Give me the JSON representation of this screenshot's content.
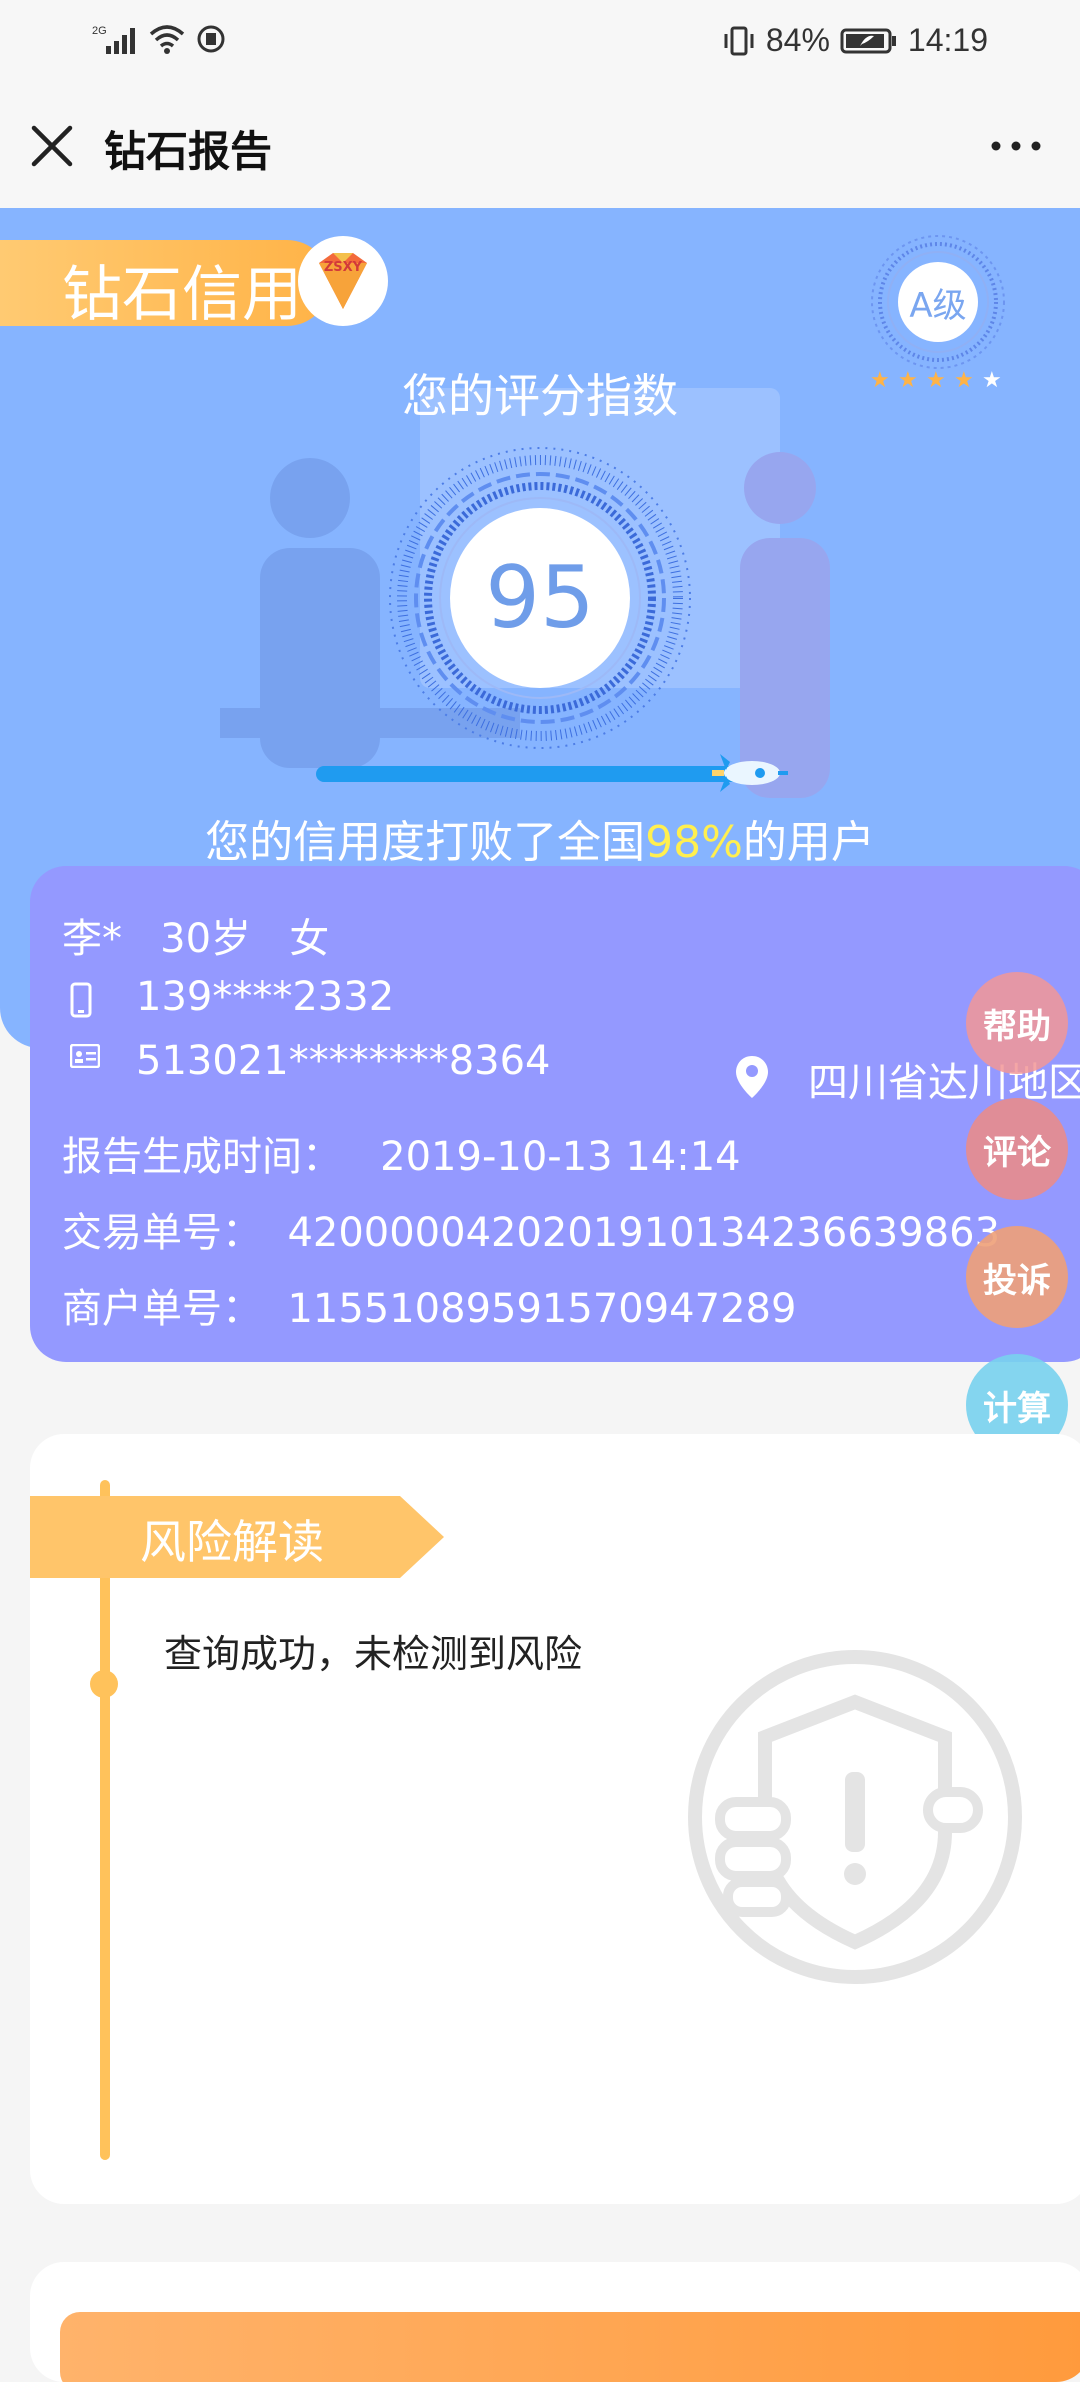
{
  "status_bar": {
    "network": "2G",
    "battery": "84%",
    "time": "14:19"
  },
  "titlebar": {
    "title": "钻石报告"
  },
  "hero": {
    "brand": "钻石信用",
    "logo_text": "ZSXY",
    "grade": "A级",
    "stars": 5,
    "score_caption": "您的评分指数",
    "score": "95",
    "beat_prefix": "您的信用度打败了全国",
    "beat_percent": "98%",
    "beat_suffix": "的用户",
    "progress": 0.9
  },
  "profile": {
    "name": "李*",
    "age": "30岁",
    "gender": "女",
    "phone": "139****2332",
    "id_number": "513021********8364",
    "location": "四川省达川地区",
    "report_time_label": "报告生成时间：",
    "report_time": "2019-10-13  14:14",
    "trade_no_label": "交易单号：",
    "trade_no": "4200000420201910134236639863",
    "merchant_no_label": "商户单号：",
    "merchant_no": "11551089591570947289"
  },
  "float_buttons": [
    {
      "label": "帮助",
      "color": "#f2a6a6"
    },
    {
      "label": "评论",
      "color": "#e98f8f"
    },
    {
      "label": "投诉",
      "color": "#f0a27a"
    },
    {
      "label": "计算",
      "color": "#7fd3ef"
    }
  ],
  "risk": {
    "title": "风险解读",
    "text": "查询成功，未检测到风险"
  }
}
